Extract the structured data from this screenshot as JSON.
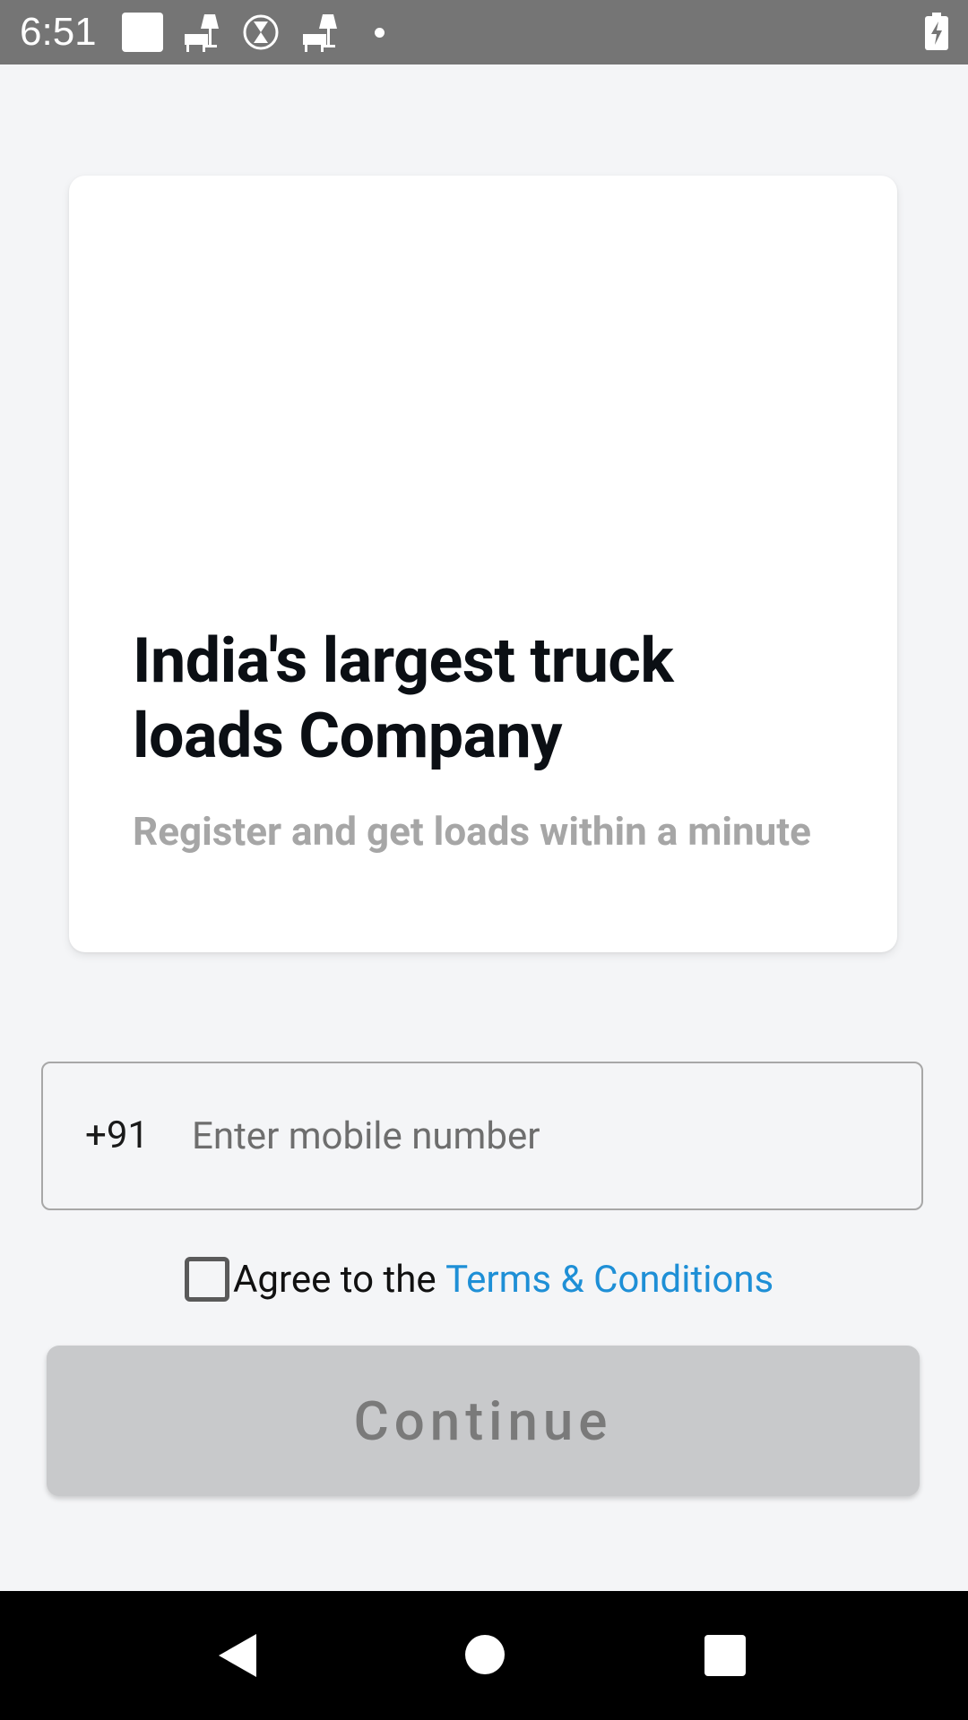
{
  "status_bar": {
    "time": "6:51",
    "icons": [
      "square-notification-icon",
      "lamp-icon",
      "timer-icon",
      "lamp-icon",
      "dot-icon",
      "battery-charging-icon"
    ]
  },
  "hero": {
    "title": "India's largest truck loads Company",
    "subtitle": "Register and get loads within a minute"
  },
  "phone": {
    "country_code": "+91",
    "placeholder": "Enter mobile number",
    "value": ""
  },
  "terms": {
    "checked": false,
    "prefix": "Agree to the ",
    "link_label": "Terms & Conditions"
  },
  "continue_button": {
    "label": "Continue",
    "enabled": false
  },
  "nav_bar": {
    "buttons": [
      "back-icon",
      "home-icon",
      "recents-icon"
    ]
  },
  "colors": {
    "background": "#f4f5f7",
    "link": "#1e8fd6",
    "button_disabled_bg": "#c8c9cb",
    "button_disabled_text": "#7a7a7a",
    "title": "#0b0f14",
    "subtitle": "#a6a6a6"
  }
}
